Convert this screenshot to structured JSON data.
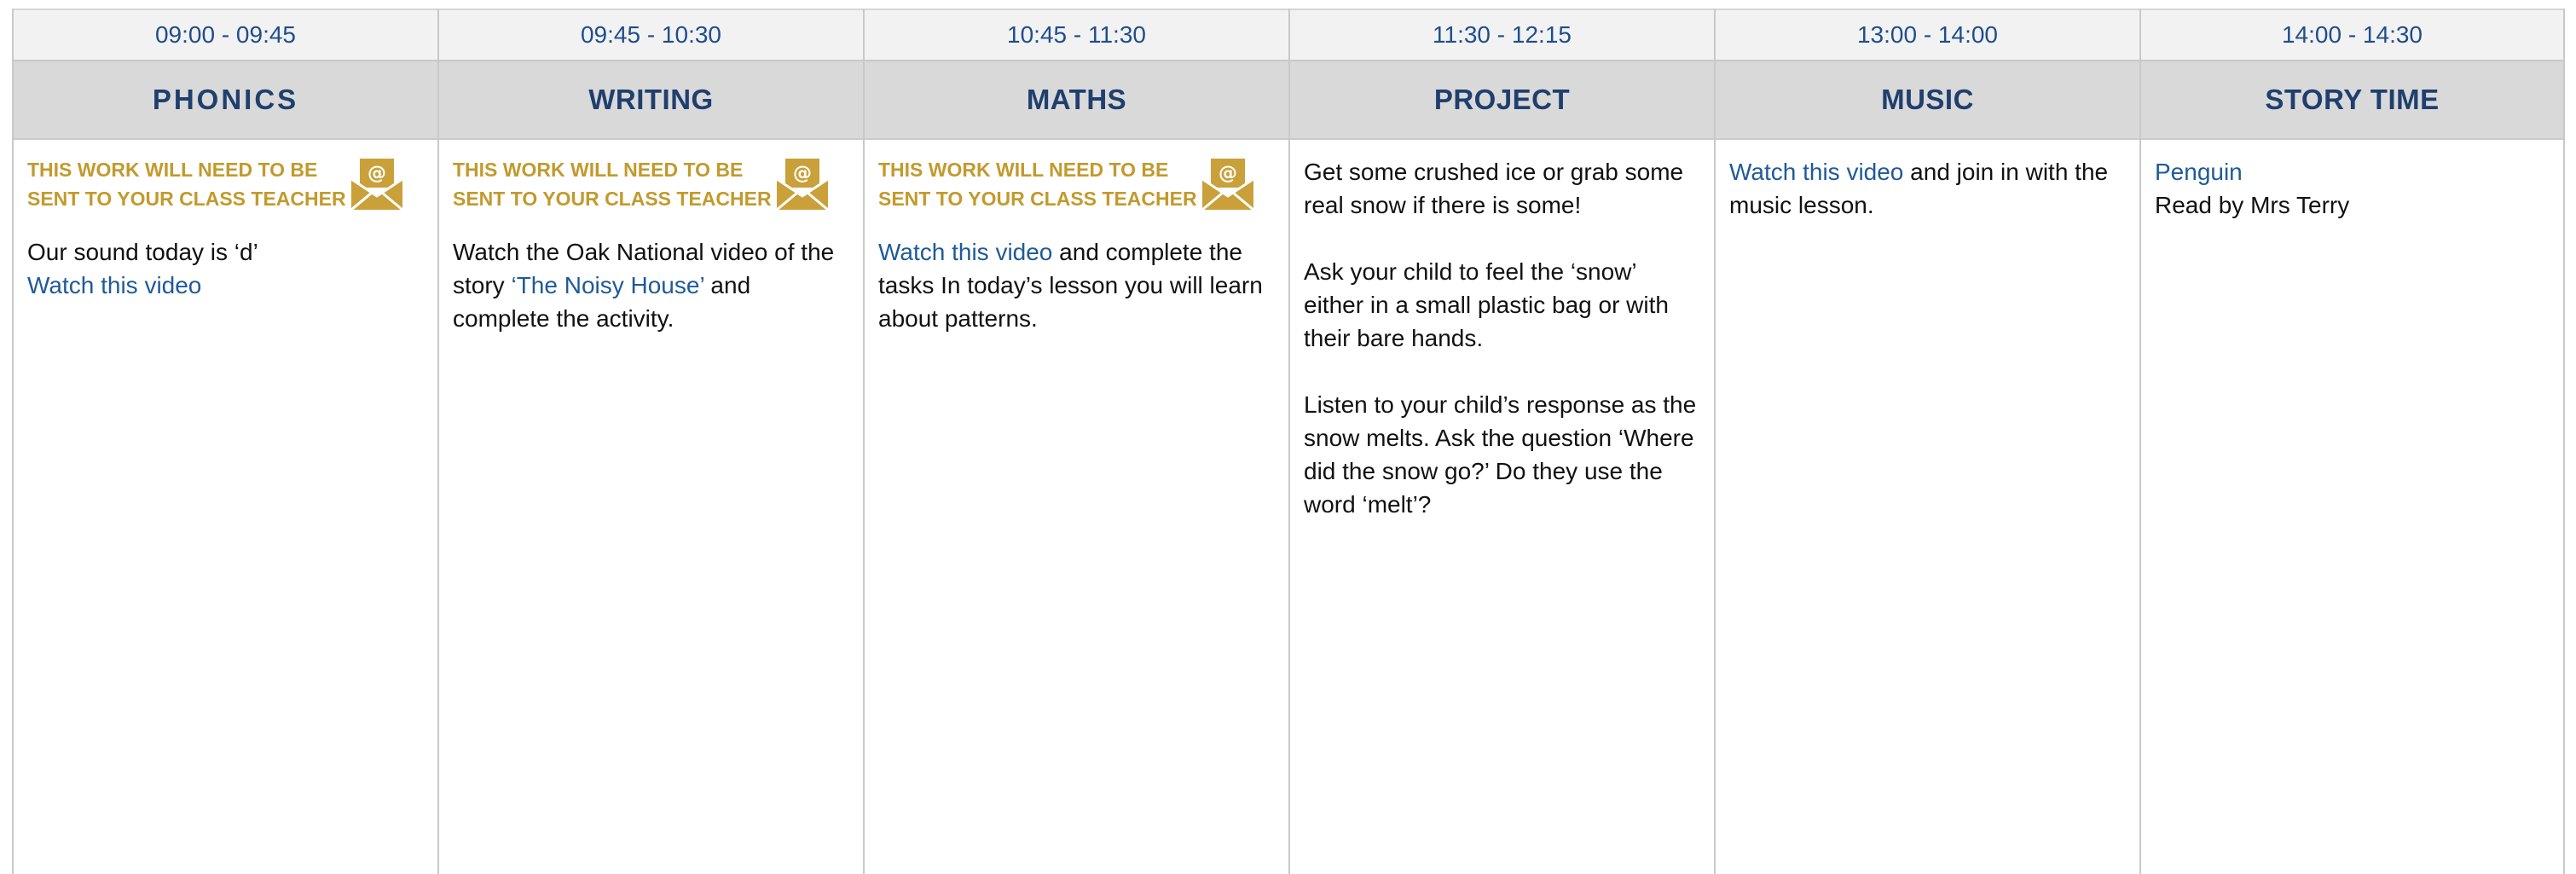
{
  "columns": [
    {
      "time": "09:00  - 09:45",
      "subject": "PHONICS",
      "notice": [
        "THIS WORK WILL NEED TO BE",
        "SENT TO YOUR CLASS TEACHER"
      ],
      "body_text": "Our sound today is ‘d’",
      "link": "Watch this video"
    },
    {
      "time": "09:45  - 10:30",
      "subject": "WRITING",
      "notice": [
        "THIS WORK WILL NEED TO BE",
        "SENT TO YOUR CLASS TEACHER"
      ],
      "text_before": "Watch the Oak National video of the story ",
      "link": "‘The Noisy House’",
      "text_after": " and complete the activity."
    },
    {
      "time": "10:45  - 11:30",
      "subject": "MATHS",
      "notice": [
        "THIS WORK WILL NEED TO BE",
        "SENT TO YOUR CLASS TEACHER"
      ],
      "link": "Watch this video",
      "text_after": " and complete the tasks In today’s lesson you will learn about patterns."
    },
    {
      "time": "11:30  - 12:15",
      "subject": "PROJECT",
      "paragraphs": [
        "Get some crushed ice or grab some real snow if there is some!",
        "Ask your child to feel the ‘snow’ either in a small plastic bag or with their bare hands.",
        "Listen to your child’s response as the snow melts. Ask the question ‘Where did the snow go?’ Do they use the word ‘melt’?"
      ]
    },
    {
      "time": "13:00  - 14:00",
      "subject": "MUSIC",
      "link": "Watch this video",
      "text_after": " and join in with the music lesson."
    },
    {
      "time": "14:00  - 14:30",
      "subject": "STORY TIME",
      "link": "Penguin",
      "text_after": "Read by Mrs Terry"
    }
  ],
  "colors": {
    "time_text": "#1f4e8c",
    "subject_text": "#1f3f6e",
    "notice_text": "#c29a2d",
    "link": "#1f5a99",
    "header_bg": "#d9d9d9",
    "time_bg": "#f2f2f2"
  },
  "icons": {
    "notice_icon": "envelope-at-icon"
  }
}
